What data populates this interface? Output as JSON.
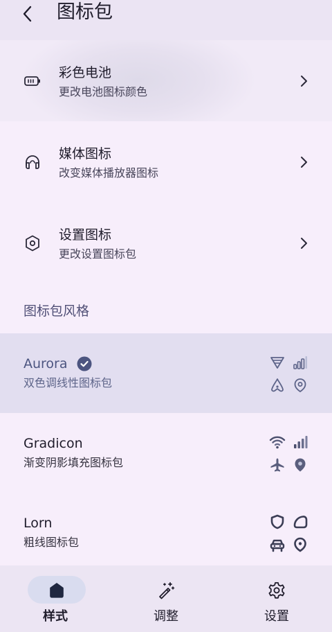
{
  "header": {
    "title": "图标包",
    "back_icon": "back-arrow-icon"
  },
  "settings": [
    {
      "title": "彩色电池",
      "subtitle": "更改电池图标颜色",
      "icon": "battery-icon"
    },
    {
      "title": "媒体图标",
      "subtitle": "改变媒体播放器图标",
      "icon": "headphones-icon"
    },
    {
      "title": "设置图标",
      "subtitle": "更改设置图标包",
      "icon": "hexagon-settings-icon"
    }
  ],
  "section": {
    "title": "图标包风格"
  },
  "packs": [
    {
      "name": "Aurora",
      "subtitle": "双色调线性图标包",
      "selected": true
    },
    {
      "name": "Gradicon",
      "subtitle": "渐变阴影填充图标包",
      "selected": false
    },
    {
      "name": "Lorn",
      "subtitle": "粗线图标包",
      "selected": false
    }
  ],
  "nav": [
    {
      "label": "样式",
      "icon": "home-icon",
      "active": true
    },
    {
      "label": "调整",
      "icon": "magic-wand-icon",
      "active": false
    },
    {
      "label": "设置",
      "icon": "gear-icon",
      "active": false
    }
  ],
  "colors": {
    "background": "#f7eefb",
    "topbar": "#ebe4f3",
    "selected_row": "#e2def0",
    "accent": "#4c5580",
    "nav_active_pill": "#d9dcef"
  }
}
